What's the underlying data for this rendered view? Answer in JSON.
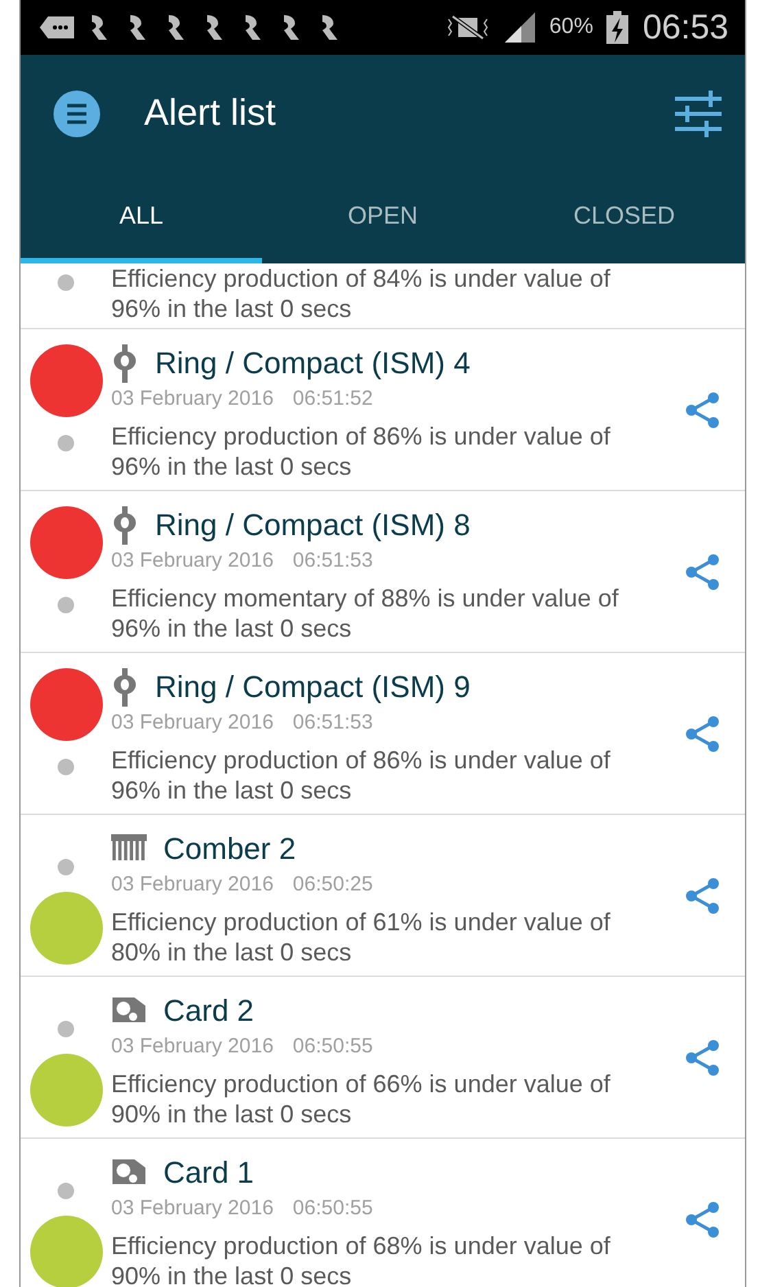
{
  "status_bar": {
    "battery": "60%",
    "time": "06:53"
  },
  "app_bar": {
    "title": "Alert list"
  },
  "tabs": [
    {
      "label": "ALL",
      "selected": true
    },
    {
      "label": "OPEN",
      "selected": false
    },
    {
      "label": "CLOSED",
      "selected": false
    }
  ],
  "partial_alert": {
    "description": "Efficiency production of 84% is under value of 96% in the last 0 secs"
  },
  "alerts": [
    {
      "open": true,
      "color": "#ee3333",
      "kind": "ring",
      "title": "Ring / Compact (ISM) 4",
      "date": "03 February 2016",
      "time": "06:51:52",
      "description": "Efficiency production of 86% is under value of 96% in the last 0 secs"
    },
    {
      "open": true,
      "color": "#ee3333",
      "kind": "ring",
      "title": "Ring / Compact (ISM) 8",
      "date": "03 February 2016",
      "time": "06:51:53",
      "description": "Efficiency momentary of 88% is under value of 96% in the last 0 secs"
    },
    {
      "open": true,
      "color": "#ee3333",
      "kind": "ring",
      "title": "Ring / Compact (ISM) 9",
      "date": "03 February 2016",
      "time": "06:51:53",
      "description": "Efficiency production of 86% is under value of 96% in the last 0 secs"
    },
    {
      "open": false,
      "color": "#b5cf3e",
      "kind": "comber",
      "title": "Comber 2",
      "date": "03 February 2016",
      "time": "06:50:25",
      "description": "Efficiency production of 61% is under value of 80% in the last 0 secs"
    },
    {
      "open": false,
      "color": "#b5cf3e",
      "kind": "card",
      "title": "Card 2",
      "date": "03 February 2016",
      "time": "06:50:55",
      "description": "Efficiency production of 66% is under value of 90% in the last 0 secs"
    },
    {
      "open": false,
      "color": "#b5cf3e",
      "kind": "card",
      "title": "Card 1",
      "date": "03 February 2016",
      "time": "06:50:55",
      "description": "Efficiency production of 68% is under value of 90% in the last 0 secs"
    }
  ]
}
